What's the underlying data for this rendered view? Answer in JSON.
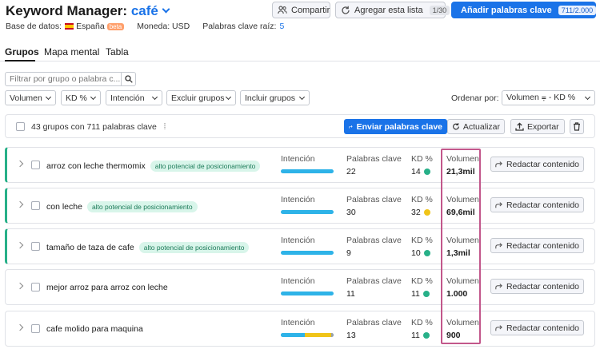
{
  "header": {
    "title": "Keyword Manager:",
    "keyword": "café",
    "share_label": "Compartir",
    "add_list_label": "Agregar esta lista",
    "add_list_count": "1/30",
    "add_keywords_label": "Añadir palabras clave",
    "add_keywords_count": "711/2.000"
  },
  "meta": {
    "database_label": "Base de datos:",
    "database_value": "España",
    "beta_label": "beta",
    "currency_label": "Moneda: USD",
    "seed_label": "Palabras clave raíz:",
    "seed_count": "5"
  },
  "tabs": [
    {
      "label": "Grupos"
    },
    {
      "label": "Mapa mental"
    },
    {
      "label": "Tabla"
    }
  ],
  "filters": {
    "search_placeholder": "Filtrar por grupo o palabra c...",
    "dropdowns": [
      "Volumen",
      "KD %",
      "Intención",
      "Excluir grupos",
      "Incluir grupos"
    ],
    "sort_label": "Ordenar por:",
    "sort_value": "Volumen ⩦ - KD %"
  },
  "summary": {
    "text": "43 grupos con 711 palabras clave",
    "send_label": "Enviar palabras clave",
    "refresh_label": "Actualizar",
    "export_label": "Exportar"
  },
  "columns": {
    "intent": "Intención",
    "keywords": "Palabras clave",
    "kd": "KD %",
    "volume": "Volumen",
    "write_label": "Redactar contenido"
  },
  "colors": {
    "accent": "#1a73e8",
    "green": "#27b088",
    "yellow": "#f0c419",
    "highlight": "#c2578b",
    "intent_blue": "#2eb3e8"
  },
  "rows": [
    {
      "name": "arroz con leche thermomix",
      "tag": "alto potencial de posicionamiento",
      "keywords": "22",
      "kd": "14",
      "kd_color": "#27b088",
      "volume": "21,3mil",
      "intent_segments": [
        {
          "color": "#2eb3e8",
          "share": 1
        }
      ]
    },
    {
      "name": "con leche",
      "tag": "alto potencial de posicionamiento",
      "keywords": "30",
      "kd": "32",
      "kd_color": "#f0c419",
      "volume": "69,6mil",
      "intent_segments": [
        {
          "color": "#2eb3e8",
          "share": 1
        }
      ]
    },
    {
      "name": "tamaño de taza de cafe",
      "tag": "alto potencial de posicionamiento",
      "keywords": "9",
      "kd": "10",
      "kd_color": "#27b088",
      "volume": "1,3mil",
      "intent_segments": [
        {
          "color": "#2eb3e8",
          "share": 1
        }
      ]
    },
    {
      "name": "mejor arroz para arroz con leche",
      "tag": "",
      "keywords": "11",
      "kd": "11",
      "kd_color": "#27b088",
      "volume": "1.000",
      "intent_segments": [
        {
          "color": "#2eb3e8",
          "share": 1
        }
      ]
    },
    {
      "name": "cafe molido para maquina",
      "tag": "",
      "keywords": "13",
      "kd": "11",
      "kd_color": "#27b088",
      "volume": "900",
      "intent_segments": [
        {
          "color": "#2eb3e8",
          "share": 0.45
        },
        {
          "color": "#f0c419",
          "share": 0.5
        },
        {
          "color": "#9aa0aa",
          "share": 0.05
        }
      ]
    }
  ]
}
